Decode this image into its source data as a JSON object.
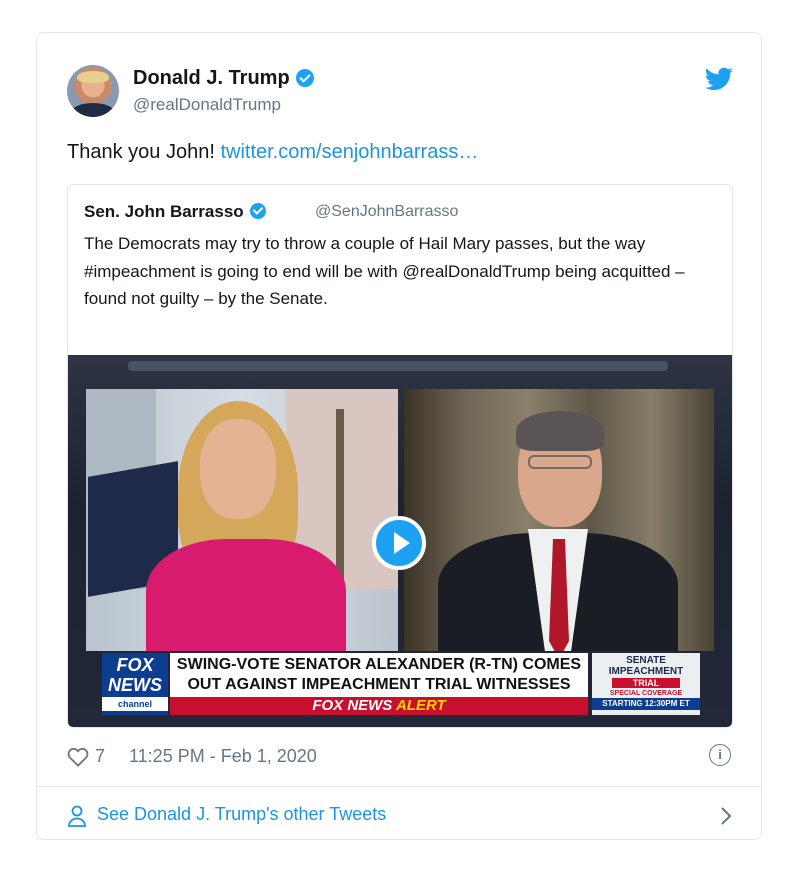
{
  "tweet": {
    "author_name": "Donald J. Trump",
    "author_handle": "@realDonaldTrump",
    "text": "Thank you John! ",
    "link_text": "twitter.com/senjohnbarrass…",
    "likes": "7",
    "timestamp": "11:25 PM - Feb 1, 2020"
  },
  "quoted_tweet": {
    "author_name": "Sen. John Barrasso",
    "author_handle": "@SenJohnBarrasso",
    "text": "The Democrats may try to throw a couple of Hail Mary passes, but the way #impeachment is going to end will be with @realDonaldTrump being acquitted – found not guilty – by the Senate."
  },
  "video": {
    "logo_line1": "FOX",
    "logo_line2": "NEWS",
    "logo_line3": "channel",
    "headline": "SWING-VOTE SENATOR ALEXANDER (R-TN) COMES OUT AGAINST IMPEACHMENT TRIAL WITNESSES",
    "alert_prefix": "FOX NEWS",
    "alert_word": " ALERT",
    "box_line1": "SENATE",
    "box_line2": "IMPEACHMENT",
    "box_line3": "TRIAL",
    "box_line4": "SPECIAL COVERAGE",
    "box_line5": "STARTING 12:30PM ET"
  },
  "footer": {
    "link_label": "See Donald J. Trump's other Tweets"
  },
  "icons": {
    "brand": "twitter-bird-icon",
    "verified": "verified-badge-icon",
    "play": "play-icon",
    "like": "heart-icon",
    "info": "info-icon",
    "user": "user-icon",
    "chevron": "chevron-right-icon"
  },
  "colors": {
    "brand_blue": "#1da1f2",
    "link_blue": "#1b95e0",
    "muted_gray": "#657786",
    "border": "#e1e8ed"
  }
}
